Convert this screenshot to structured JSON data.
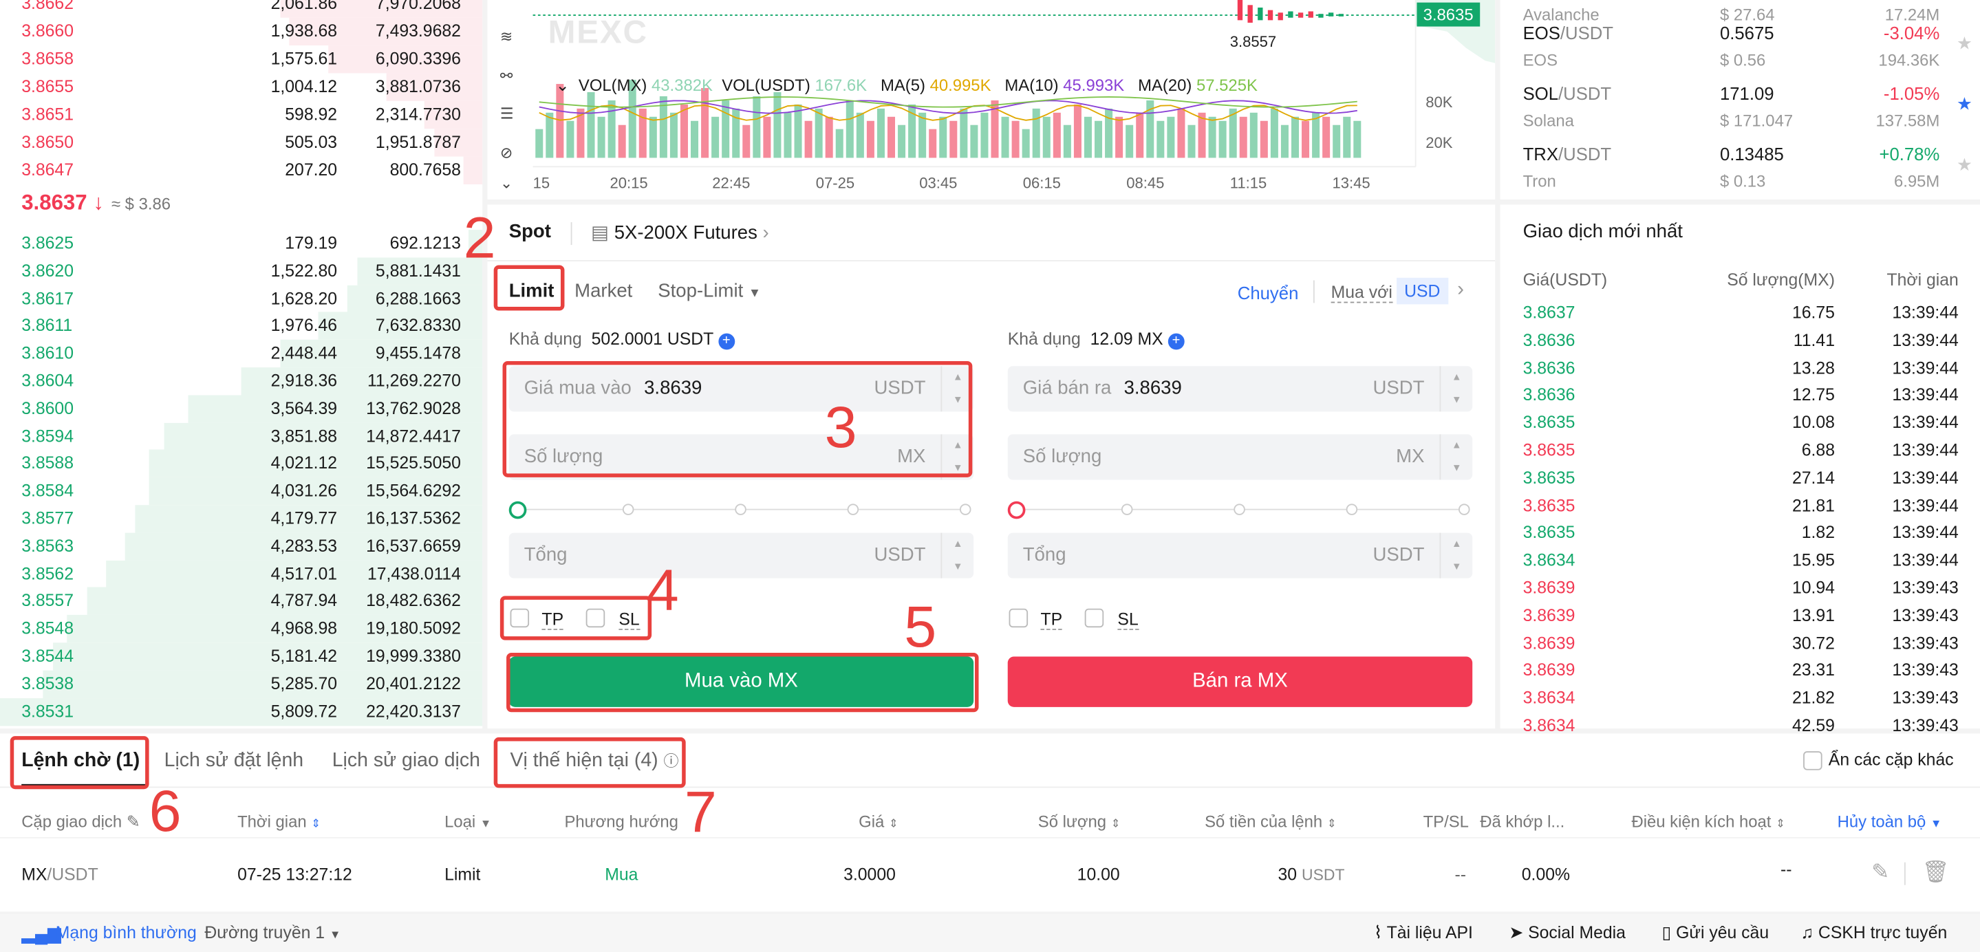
{
  "orderbook": {
    "asks": [
      {
        "price": "3.8662",
        "amount": "2,061.86",
        "total": "7,970.2068"
      },
      {
        "price": "3.8660",
        "amount": "1,938.68",
        "total": "7,493.9682"
      },
      {
        "price": "3.8658",
        "amount": "1,575.61",
        "total": "6,090.3396"
      },
      {
        "price": "3.8655",
        "amount": "1,004.12",
        "total": "3,881.0736"
      },
      {
        "price": "3.8651",
        "amount": "598.92",
        "total": "2,314.7730"
      },
      {
        "price": "3.8650",
        "amount": "505.03",
        "total": "1,951.8787"
      },
      {
        "price": "3.8647",
        "amount": "207.20",
        "total": "800.7658"
      }
    ],
    "last_price": "3.8637",
    "arrow": "↓",
    "last_usd": "≈ $ 3.86",
    "bids": [
      {
        "price": "3.8625",
        "amount": "179.19",
        "total": "692.1213",
        "depth": 0.03
      },
      {
        "price": "3.8620",
        "amount": "1,522.80",
        "total": "5,881.1431",
        "depth": 0.26
      },
      {
        "price": "3.8617",
        "amount": "1,628.20",
        "total": "6,288.1663",
        "depth": 0.28
      },
      {
        "price": "3.8611",
        "amount": "1,976.46",
        "total": "7,632.8330",
        "depth": 0.34
      },
      {
        "price": "3.8610",
        "amount": "2,448.44",
        "total": "9,455.1478",
        "depth": 0.42
      },
      {
        "price": "3.8604",
        "amount": "2,918.36",
        "total": "11,269.2270",
        "depth": 0.5
      },
      {
        "price": "3.8600",
        "amount": "3,564.39",
        "total": "13,762.9028",
        "depth": 0.61
      },
      {
        "price": "3.8594",
        "amount": "3,851.88",
        "total": "14,872.4417",
        "depth": 0.66
      },
      {
        "price": "3.8588",
        "amount": "4,021.12",
        "total": "15,525.5050",
        "depth": 0.69
      },
      {
        "price": "3.8584",
        "amount": "4,031.26",
        "total": "15,564.6292",
        "depth": 0.69
      },
      {
        "price": "3.8577",
        "amount": "4,179.77",
        "total": "16,137.5362",
        "depth": 0.72
      },
      {
        "price": "3.8563",
        "amount": "4,283.53",
        "total": "16,537.6659",
        "depth": 0.74
      },
      {
        "price": "3.8562",
        "amount": "4,517.01",
        "total": "17,438.0114",
        "depth": 0.78
      },
      {
        "price": "3.8557",
        "amount": "4,787.94",
        "total": "18,482.6362",
        "depth": 0.82
      },
      {
        "price": "3.8548",
        "amount": "4,968.98",
        "total": "19,180.5092",
        "depth": 0.86
      },
      {
        "price": "3.8544",
        "amount": "5,181.42",
        "total": "19,999.3380",
        "depth": 0.89
      },
      {
        "price": "3.8538",
        "amount": "5,285.70",
        "total": "20,401.2122",
        "depth": 0.91
      },
      {
        "price": "3.8531",
        "amount": "5,809.72",
        "total": "22,420.3137",
        "depth": 1.0
      }
    ]
  },
  "chart": {
    "watermark": "MEXC",
    "price_tag": "3.8635",
    "low_label": "3.8557",
    "vol_legend": {
      "vol_mx": "VOL(MX)",
      "vol_mx_val": "43.382K",
      "vol_usdt": "VOL(USDT)",
      "vol_usdt_val": "167.6K",
      "ma5": "MA(5)",
      "ma5_val": "40.995K",
      "ma10": "MA(10)",
      "ma10_val": "45.993K",
      "ma20": "MA(20)",
      "ma20_val": "57.525K"
    },
    "y_ticks": [
      "80K",
      "20K"
    ],
    "x_ticks": [
      "15",
      "20:15",
      "22:45",
      "07-25",
      "03:45",
      "06:15",
      "08:45",
      "11:15",
      "13:45"
    ],
    "volumes": [
      0.35,
      0.55,
      0.9,
      0.45,
      0.6,
      0.8,
      0.5,
      0.7,
      0.4,
      0.95,
      0.6,
      0.5,
      0.75,
      0.55,
      0.65,
      0.45,
      0.85,
      0.5,
      0.7,
      0.6,
      0.4,
      0.75,
      0.5,
      0.8,
      0.55,
      0.65,
      0.45,
      0.6,
      0.5,
      0.35,
      0.7,
      0.55,
      0.45,
      0.6,
      0.5,
      0.4,
      0.65,
      0.55,
      0.35,
      0.5,
      0.45,
      0.6,
      0.4,
      0.55,
      0.7,
      0.5,
      0.45,
      0.35,
      0.6,
      0.5,
      0.55,
      0.4,
      0.65,
      0.5,
      0.45,
      0.6,
      0.5,
      0.4,
      0.55,
      0.7,
      0.45,
      0.5,
      0.6,
      0.4,
      0.55,
      0.5,
      0.45,
      0.6,
      0.5,
      0.55,
      0.45,
      0.6,
      0.4,
      0.5,
      0.45,
      0.55,
      0.5,
      0.4,
      0.5,
      0.45
    ],
    "vol_colors": [
      "#f58a9a",
      "#8fd4b3"
    ]
  },
  "form": {
    "tab_spot": "Spot",
    "tab_futures": "5X-200X Futures",
    "tab_limit": "Limit",
    "tab_market": "Market",
    "tab_stoplimit": "Stop-Limit",
    "transfer": "Chuyển",
    "buy_with": "Mua với",
    "currency": "USD",
    "buy": {
      "avail_label": "Khả dụng",
      "avail_value": "502.0001 USDT",
      "price_label": "Giá mua vào",
      "price_value": "3.8639",
      "price_unit": "USDT",
      "qty_label": "Số lượng",
      "qty_unit": "MX",
      "total_label": "Tổng",
      "total_unit": "USDT",
      "tp": "TP",
      "sl": "SL",
      "button": "Mua vào MX"
    },
    "sell": {
      "avail_label": "Khả dụng",
      "avail_value": "12.09 MX",
      "price_label": "Giá bán ra",
      "price_value": "3.8639",
      "price_unit": "USDT",
      "qty_label": "Số lượng",
      "qty_unit": "MX",
      "total_label": "Tổng",
      "total_unit": "USDT",
      "tp": "TP",
      "sl": "SL",
      "button": "Bán ra MX"
    },
    "colors": {
      "buy": "#13a86b",
      "sell": "#f23a54",
      "accent": "#2f6ef0"
    }
  },
  "market": {
    "rows": [
      {
        "sym": "",
        "quote": "",
        "price": "",
        "change": "",
        "sub": "Avalanche",
        "sub_price": "$ 27.64",
        "vol": "17.24M"
      },
      {
        "sym": "EOS",
        "quote": "/USDT",
        "price": "0.5675",
        "change": "-3.04%",
        "sub": "EOS",
        "sub_price": "$ 0.56",
        "vol": "194.36K",
        "fav": false
      },
      {
        "sym": "SOL",
        "quote": "/USDT",
        "price": "171.09",
        "change": "-1.05%",
        "sub": "Solana",
        "sub_price": "$ 171.047",
        "vol": "137.58M",
        "fav": true
      },
      {
        "sym": "TRX",
        "quote": "/USDT",
        "price": "0.13485",
        "change": "+0.78%",
        "sub": "Tron",
        "sub_price": "$ 0.13",
        "vol": "6.95M",
        "fav": false
      }
    ]
  },
  "trades": {
    "title": "Giao dịch mới nhất",
    "col_price": "Giá(USDT)",
    "col_qty": "Số lượng(MX)",
    "col_time": "Thời gian",
    "rows": [
      {
        "price": "3.8637",
        "qty": "16.75",
        "time": "13:39:44",
        "side": "buy"
      },
      {
        "price": "3.8636",
        "qty": "11.41",
        "time": "13:39:44",
        "side": "buy"
      },
      {
        "price": "3.8636",
        "qty": "13.28",
        "time": "13:39:44",
        "side": "buy"
      },
      {
        "price": "3.8636",
        "qty": "12.75",
        "time": "13:39:44",
        "side": "buy"
      },
      {
        "price": "3.8635",
        "qty": "10.08",
        "time": "13:39:44",
        "side": "buy"
      },
      {
        "price": "3.8635",
        "qty": "6.88",
        "time": "13:39:44",
        "side": "sell"
      },
      {
        "price": "3.8635",
        "qty": "27.14",
        "time": "13:39:44",
        "side": "buy"
      },
      {
        "price": "3.8635",
        "qty": "21.81",
        "time": "13:39:44",
        "side": "sell"
      },
      {
        "price": "3.8635",
        "qty": "1.82",
        "time": "13:39:44",
        "side": "buy"
      },
      {
        "price": "3.8634",
        "qty": "15.95",
        "time": "13:39:44",
        "side": "buy"
      },
      {
        "price": "3.8639",
        "qty": "10.94",
        "time": "13:39:43",
        "side": "sell"
      },
      {
        "price": "3.8639",
        "qty": "13.91",
        "time": "13:39:43",
        "side": "sell"
      },
      {
        "price": "3.8639",
        "qty": "30.72",
        "time": "13:39:43",
        "side": "sell"
      },
      {
        "price": "3.8639",
        "qty": "23.31",
        "time": "13:39:43",
        "side": "sell"
      },
      {
        "price": "3.8634",
        "qty": "21.82",
        "time": "13:39:43",
        "side": "sell"
      },
      {
        "price": "3.8634",
        "qty": "42.59",
        "time": "13:39:43",
        "side": "sell"
      }
    ]
  },
  "orders": {
    "tab_open": "Lệnh chờ (1)",
    "tab_history": "Lịch sử đặt lệnh",
    "tab_trades": "Lịch sử giao dịch",
    "tab_positions": "Vị thế hiện tại (4)",
    "hide_pairs": "Ẩn các cặp khác",
    "cols": [
      "Cặp giao dịch",
      "Thời gian",
      "Loại",
      "Phương hướng",
      "Giá",
      "Số lượng",
      "Số tiền của lệnh",
      "TP/SL",
      "Đã khớp l...",
      "Điều kiện kích hoạt",
      "Hủy toàn bộ"
    ],
    "row": {
      "pair": "MX",
      "pair_quote": "/USDT",
      "time": "07-25 13:27:12",
      "type": "Limit",
      "side": "Mua",
      "price": "3.0000",
      "qty": "10.00",
      "amount": "30",
      "amount_unit": "USDT",
      "tpsl": "--",
      "filled": "0.00%",
      "trigger": "--"
    }
  },
  "status": {
    "network": "Mạng bình thường",
    "route": "Đường truyền 1",
    "api": "Tài liệu API",
    "social": "Social Media",
    "request": "Gửi yêu cầu",
    "support": "CSKH trực tuyến"
  },
  "annotations": [
    "2",
    "3",
    "4",
    "5",
    "6",
    "7"
  ]
}
